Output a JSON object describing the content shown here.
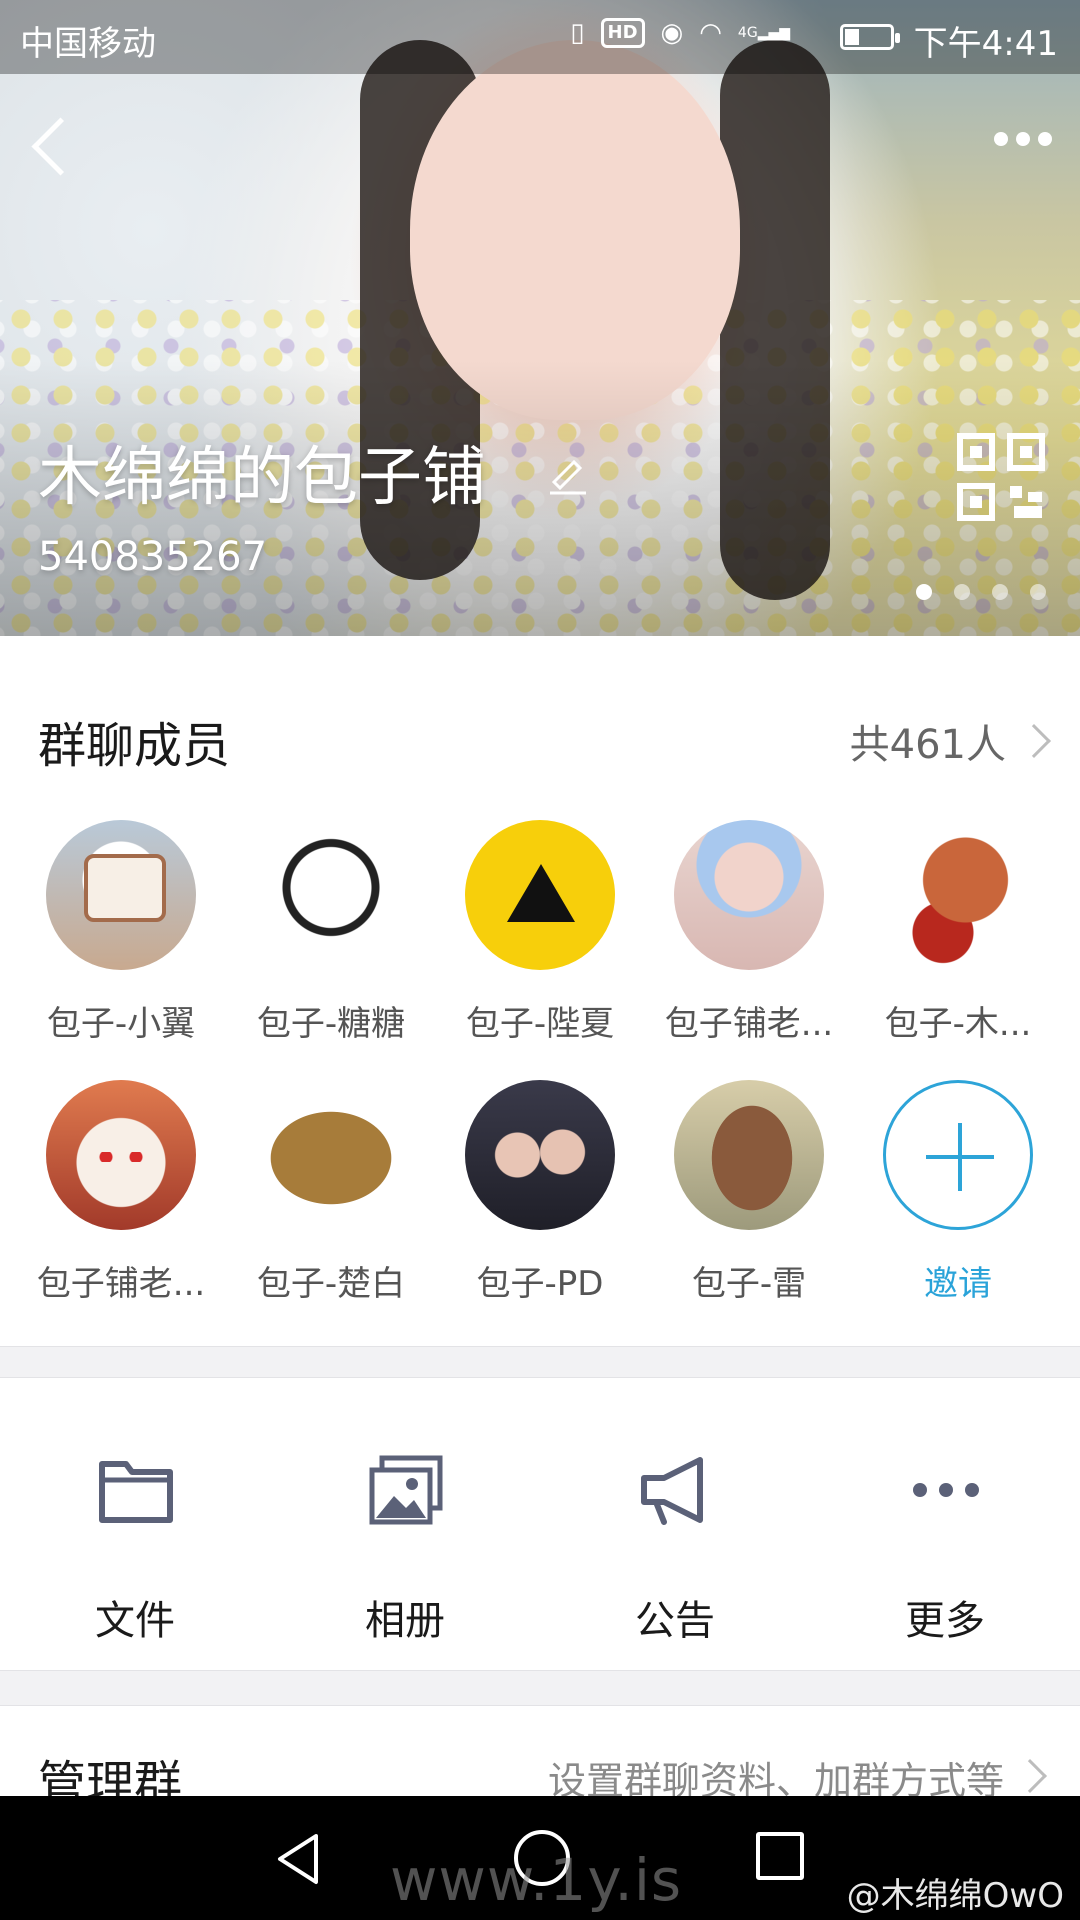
{
  "status_bar": {
    "carrier": "中国移动",
    "network": "4G",
    "hd": "HD",
    "time": "下午4:41"
  },
  "header": {
    "group_name": "木绵绵的包子铺",
    "group_id": "540835267",
    "back_icon": "back-arrow-icon",
    "more_icon": "more-dots-icon",
    "qr_icon": "qr-code-icon",
    "edit_icon": "edit-pencil-icon",
    "page_dots": {
      "count": 4,
      "active": 1
    }
  },
  "members": {
    "title": "群聊成员",
    "count_label": "共461人",
    "items": [
      {
        "name": "包子-小翼"
      },
      {
        "name": "包子-糖糖"
      },
      {
        "name": "包子-陛夏"
      },
      {
        "name": "包子铺老..."
      },
      {
        "name": "包子-木..."
      },
      {
        "name": "包子铺老..."
      },
      {
        "name": "包子-楚白"
      },
      {
        "name": "包子-PD"
      },
      {
        "name": "包子-雷"
      }
    ],
    "invite_label": "邀请"
  },
  "functions": [
    {
      "label": "文件",
      "icon": "folder-icon"
    },
    {
      "label": "相册",
      "icon": "album-icon"
    },
    {
      "label": "公告",
      "icon": "megaphone-icon"
    },
    {
      "label": "更多",
      "icon": "more-dots-icon"
    }
  ],
  "manage": {
    "title": "管理群",
    "description": "设置群聊资料、加群方式等"
  },
  "watermarks": {
    "site": "www.1y.is",
    "weibo": "@木绵绵OwO"
  },
  "colors": {
    "accent_blue": "#2aa3d9",
    "text_dark": "#1a1a1a",
    "text_gray": "#555555",
    "icon_gray": "#5b6178",
    "divider": "#f2f2f4"
  }
}
